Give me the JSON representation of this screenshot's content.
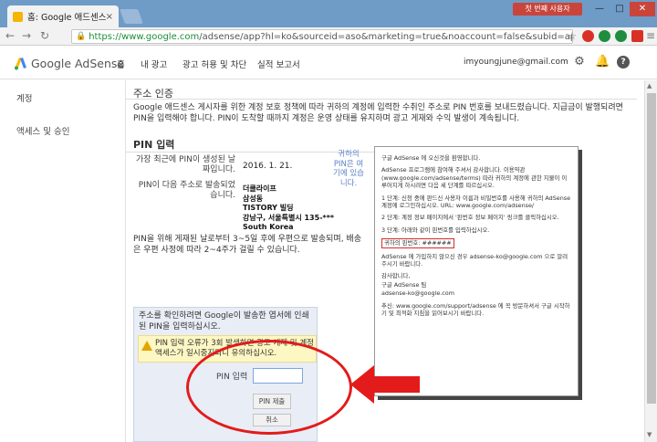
{
  "browser": {
    "tab_title": "홈: Google 애드센스",
    "tab_close": "×",
    "user_chip": "첫 번째 사용자",
    "window_min": "—",
    "window_max": "□",
    "window_close": "✕",
    "url_host": "https://www.google.com",
    "url_rest": "/adsense/app?hl=ko&sourceid=aso&marketing=true&noaccount=false&subid=ap-ko-ha-bk",
    "extension_colors": [
      "#d93025",
      "#1e8e3e",
      "#1e8e3e",
      "#d93025"
    ]
  },
  "header": {
    "logo_text": "Google AdSense",
    "nav": [
      "홈",
      "내 광고",
      "광고 허용 및 차단",
      "실적 보고서"
    ],
    "email": "imyoungjune@gmail.com",
    "logo_colors": [
      "#fbbc04",
      "#4285f4",
      "#34a853"
    ]
  },
  "sidebar": {
    "items": [
      "계정",
      "액세스 및 승인"
    ]
  },
  "main": {
    "section_title": "주소 인증",
    "intro": "Google 애드센스 게시자를 위한 계정 보호 정책에 따라 귀하의 계정에 입력한 수취인 주소로 PIN 번호를 보내드렸습니다. 지급금이 발행되려면 PIN을 입력해야 합니다. PIN이 도착할 때까지 계정은 운영 상태를 유지하며 광고 게재와 수익 발생이 계속됩니다.",
    "pin_heading": "PIN 입력",
    "generated_label": "가장 최근에 PIN이 생성된 날짜입니다.",
    "generated_date": "2016. 1. 21.",
    "sent_label": "PIN이 다음 주소로 발송되었습니다.",
    "address": [
      "더클라이프",
      "삼성동",
      "TISTORY 빌딩",
      "강남구, 서울특별시 135-***",
      "South Korea"
    ],
    "annotation": "귀하의 PIN은 여기에 있습니다.",
    "notice": "PIN을 위해 게재된 날로부터 3~5일 후에 우편으로 발송되며, 배송은 우편 사정에 따라 2~4주가 걸릴 수 있습니다."
  },
  "confirm": {
    "text": "주소를 확인하려면 Google이 발송한 엽서에 인쇄된 PIN을 입력하십시오.",
    "warning": "PIN 입력 오류가 3회 발생하면 광고 게재 및 계정 액세스가 일시중지되니 유의하십시오.",
    "pin_label": "PIN 입력",
    "pin_value": "",
    "submit": "PIN 제출",
    "cancel": "취소"
  },
  "letter": {
    "greeting": "구글 AdSense 에 오신것을 환영합니다.",
    "p1": "AdSense 프로그램에 참여해 주셔서 감사합니다. 이용약관(www.google.com/adsense/terms) 따라 귀하의 계정에 관한 지불이 이루어지게 하시려면 다음 세 단계를 따르십시오.",
    "step1": "1 단계: 신청 중에 판드신 사용자 이름과 비밀번호를 사용해 귀하의 AdSense 계정에 로그인하십시오. URL: www.google.com/adsense/",
    "step2": "2 단계: 계정 정보 페이지에서 '핀번호 정보 페이지' 링크를 클릭하십시오.",
    "step3": "3 단계: 아래와 같이 핀번호를 입력하십시오.",
    "pin_line": "귀하의 핀번호: ######",
    "help": "AdSense 에 가입하지 않으신 경우 adsense-ko@google.com 으로 알려주시기 바랍니다.",
    "thanks": "감사합니다,",
    "team": "구글 AdSense 팀",
    "team_email": "adsense-ko@google.com",
    "ps": "추신: www.google.com/support/adsense 에 꼭 방문하셔서 구글 시작하기 및 최적화 지침을 읽어보시기 바랍니다."
  }
}
